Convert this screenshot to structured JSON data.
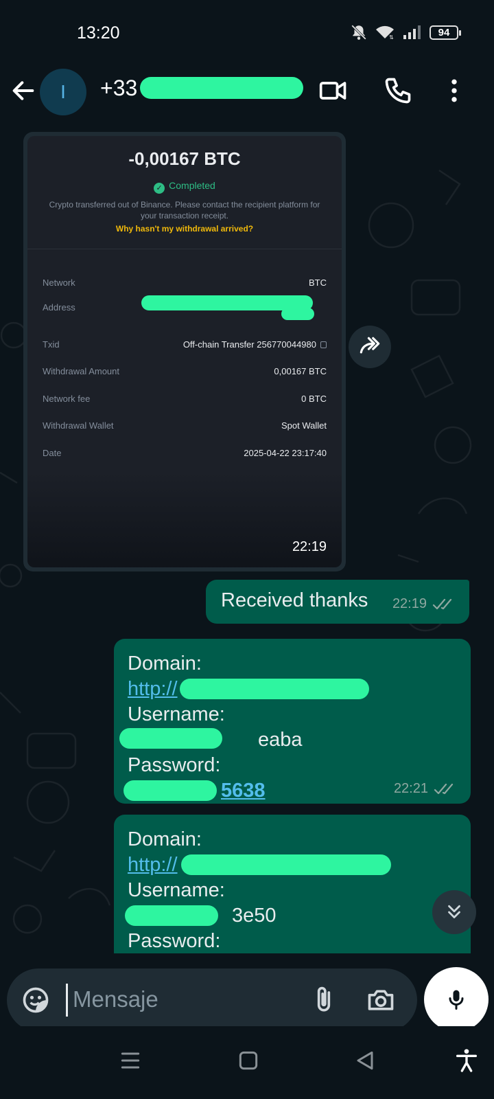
{
  "status_bar": {
    "time": "13:20",
    "battery": "94",
    "icons": [
      "do-not-disturb-icon",
      "wifi-icon",
      "signal-icon",
      "battery-icon"
    ]
  },
  "header": {
    "avatar_letter": "I",
    "contact_prefix": "+33"
  },
  "messages": {
    "image": {
      "amount": "-0,00167 BTC",
      "status": "Completed",
      "note": "Crypto transferred out of Binance. Please contact the recipient platform for your transaction receipt.",
      "help_link": "Why hasn't my withdrawal arrived?",
      "rows": [
        {
          "label": "Network",
          "value": "BTC"
        },
        {
          "label": "Address",
          "value": ""
        },
        {
          "label": "Txid",
          "value": "Off-chain Transfer 256770044980"
        },
        {
          "label": "Withdrawal Amount",
          "value": "0,00167 BTC"
        },
        {
          "label": "Network fee",
          "value": "0 BTC"
        },
        {
          "label": "Withdrawal Wallet",
          "value": "Spot Wallet"
        },
        {
          "label": "Date",
          "value": "2025-04-22 23:17:40"
        }
      ],
      "time": "22:19"
    },
    "received": {
      "text": "Received thanks",
      "time": "22:19"
    },
    "credentials_1": {
      "domain_label": "Domain:",
      "domain_value": "http://",
      "username_label": "Username:",
      "username_value": "eaba",
      "password_label": "Password:",
      "password_value": "5638",
      "time": "22:21"
    },
    "credentials_2": {
      "domain_label": "Domain:",
      "domain_value": "http://",
      "username_label": "Username:",
      "username_value": "3e50",
      "password_label": "Password:"
    }
  },
  "input": {
    "placeholder": "Mensaje"
  },
  "colors": {
    "background": "#0b141a",
    "outgoing_bubble": "#005c4b",
    "incoming_bubble": "#1f2c34",
    "link": "#53bdeb",
    "redaction": "#2ef5a0",
    "binance_green": "#2ebd85",
    "binance_yellow": "#f0b90b"
  }
}
